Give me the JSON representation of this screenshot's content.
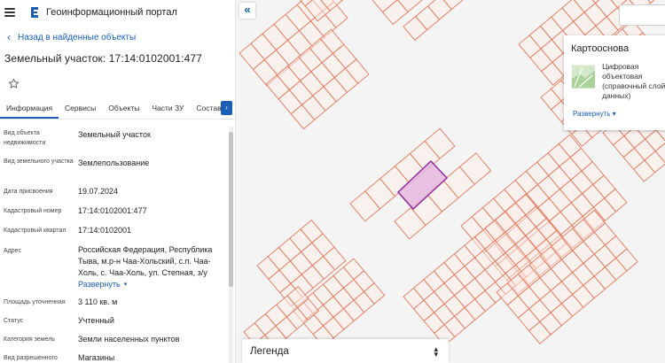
{
  "app": {
    "title": "Геоинформационный портал"
  },
  "nav": {
    "back_label": "Назад в найденные объекты"
  },
  "object": {
    "title": "Земельный участок: 17:14:0102001:477"
  },
  "tabs": [
    {
      "label": "Информация",
      "active": true
    },
    {
      "label": "Сервисы"
    },
    {
      "label": "Объекты"
    },
    {
      "label": "Части ЗУ"
    },
    {
      "label": "Состав"
    }
  ],
  "properties": [
    {
      "label": "Вид объекта недвижимости",
      "value": "Земельный участок"
    },
    {
      "label": "Вид земельного участка",
      "value": "Землепользование"
    },
    {
      "label": "Дата присвоения",
      "value": "19.07.2024"
    },
    {
      "label": "Кадастровый номер",
      "value": "17:14:0102001:477"
    },
    {
      "label": "Кадастровый квартал",
      "value": "17:14:0102001"
    },
    {
      "label": "Адрес",
      "value": "Российская Федерация, Республика Тыва, м.р-н Чаа-Хольский, с.п. Чаа-Холь, с. Чаа-Холь, ул. Степная, з/у",
      "expand_label": "Развернуть"
    },
    {
      "label": "Площадь уточненная",
      "value": "3 110 кв. м"
    },
    {
      "label": "Статус",
      "value": "Учтенный"
    },
    {
      "label": "Категория земель",
      "value": "Земли населенных пунктов"
    },
    {
      "label": "Вид разрешенного использования",
      "value": "Магазины"
    }
  ],
  "basemap": {
    "title": "Картооснова",
    "item_text": "Цифровая объектовая (справочный слой данных)",
    "expand_label": "Развернуть"
  },
  "legend": {
    "label": "Легенда"
  },
  "colors": {
    "accent": "#1a5fb4",
    "parcel_stroke": "#e07a5f",
    "parcel_fill": "#fbe3da",
    "selected_stroke": "#8e2c9c",
    "selected_fill": "#e6b9df"
  },
  "icons": {
    "menu": "hamburger-icon",
    "logo": "portal-logo-icon",
    "back": "chevron-left-icon",
    "favorite": "star-icon",
    "tabs_scroll": "chevron-right-icon",
    "collapse": "double-chevron-left-icon",
    "expand": "chevron-down-icon",
    "legend_toggle": "sort-arrows-icon"
  }
}
